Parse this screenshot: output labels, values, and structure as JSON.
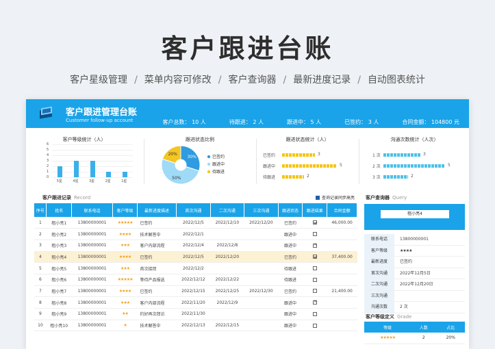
{
  "hero": {
    "title": "客户跟进台账",
    "features": [
      "客户星级管理",
      "菜单内容可修改",
      "客户查询器",
      "最新进度记录",
      "自动图表统计"
    ],
    "separator": "/"
  },
  "banner": {
    "title": "客户跟进管理台账",
    "subtitle": "Customer follow-up account",
    "stats": [
      "客户总数： 10 人",
      "待跟进： 2 人",
      "跟进中： 5 人",
      "已签约： 3 人",
      "合同金额： 104800 元"
    ],
    "accent": "#1aa3e8"
  },
  "charts": {
    "grade": {
      "title": "客户等级统计（人）",
      "y_ticks": [
        "6",
        "5",
        "4",
        "3",
        "2",
        "1",
        "0"
      ],
      "categories": [
        "5星",
        "4星",
        "3星",
        "2星",
        "1星"
      ],
      "values": [
        2,
        3,
        3,
        1,
        1
      ],
      "ylim": [
        0,
        6
      ]
    },
    "status_ratio": {
      "title": "跟进状态比例",
      "slices": [
        {
          "name": "已签约",
          "value": 30,
          "label": "30%",
          "color": "#2f9be0"
        },
        {
          "name": "跟进中",
          "value": 50,
          "label": "50%",
          "color": "#9fdaf7"
        },
        {
          "name": "待跟进",
          "value": 20,
          "label": "20%",
          "color": "#f3c623"
        }
      ]
    },
    "status_count": {
      "title": "跟进状态统计（人）",
      "rows": [
        {
          "name": "已签约",
          "value": 3
        },
        {
          "name": "跟进中",
          "value": 5
        },
        {
          "name": "待跟进",
          "value": 2
        }
      ]
    },
    "comm_count": {
      "title": "沟通次数统计（人次）",
      "rows": [
        {
          "name": "1 次",
          "value": 3
        },
        {
          "name": "2 次",
          "value": 5
        },
        {
          "name": "3 次",
          "value": 2
        }
      ]
    }
  },
  "records": {
    "title": "客户跟进记录",
    "title_en": "Record",
    "sync_label": "查询记录同步高亮",
    "columns": [
      "序号",
      "姓名",
      "联系电话",
      "客户等级",
      "最新进度描述",
      "首次沟通",
      "二次沟通",
      "三次沟通",
      "跟进状态",
      "跟进结果",
      "合同金额"
    ],
    "rows": [
      {
        "no": "1",
        "name": "租小亮1",
        "phone": "13800000001",
        "stars": "★★★★★",
        "progress": "已签约",
        "c1": "2022/12/5",
        "c2": "2022/12/10",
        "c3": "2022/12/20",
        "status": "已签约",
        "result": "on",
        "amount": "46,000.00",
        "hl": false
      },
      {
        "no": "2",
        "name": "租小亮2",
        "phone": "13800000001",
        "stars": "★★★★",
        "progress": "技术解答中",
        "c1": "2022/12/1",
        "c2": "",
        "c3": "",
        "status": "跟进中",
        "result": "off",
        "amount": "",
        "hl": false
      },
      {
        "no": "3",
        "name": "租小亮3",
        "phone": "13800000001",
        "stars": "★★★",
        "progress": "客户内部流程",
        "c1": "2022/12/4",
        "c2": "2022/12/8",
        "c3": "",
        "status": "跟进中",
        "result": "x",
        "amount": "",
        "hl": false
      },
      {
        "no": "4",
        "name": "租小亮4",
        "phone": "13800000001",
        "stars": "★★★★",
        "progress": "已签约",
        "c1": "2022/12/5",
        "c2": "2022/12/20",
        "c3": "",
        "status": "已签约",
        "result": "on",
        "amount": "37,400.00",
        "hl": true
      },
      {
        "no": "5",
        "name": "租小亮5",
        "phone": "13800000001",
        "stars": "★★★",
        "progress": "首次接拜",
        "c1": "2022/12/2",
        "c2": "",
        "c3": "",
        "status": "待跟进",
        "result": "off",
        "amount": "",
        "hl": false
      },
      {
        "no": "6",
        "name": "租小亮6",
        "phone": "13800000001",
        "stars": "★★★★★",
        "progress": "等待产品报选",
        "c1": "2022/12/12",
        "c2": "2022/12/22",
        "c3": "",
        "status": "待跟进",
        "result": "off",
        "amount": "",
        "hl": false
      },
      {
        "no": "7",
        "name": "租小亮7",
        "phone": "13800000001",
        "stars": "★★★★",
        "progress": "已签约",
        "c1": "2022/12/15",
        "c2": "2022/12/25",
        "c3": "2022/12/30",
        "status": "已签约",
        "result": "off",
        "amount": "21,400.00",
        "hl": false
      },
      {
        "no": "8",
        "name": "租小亮8",
        "phone": "13800000001",
        "stars": "★★★",
        "progress": "客户内部流程",
        "c1": "2022/11/20",
        "c2": "2022/12/9",
        "c3": "",
        "status": "跟进中",
        "result": "x",
        "amount": "",
        "hl": false
      },
      {
        "no": "9",
        "name": "租小亮9",
        "phone": "13800000001",
        "stars": "★★",
        "progress": "约好再次拜访",
        "c1": "2022/11/30",
        "c2": "",
        "c3": "",
        "status": "跟进中",
        "result": "off",
        "amount": "",
        "hl": false
      },
      {
        "no": "10",
        "name": "租小亮10",
        "phone": "13800000001",
        "stars": "★",
        "progress": "技术解答中",
        "c1": "2022/12/13",
        "c2": "2022/12/15",
        "c3": "",
        "status": "跟进中",
        "result": "off",
        "amount": "",
        "hl": false
      }
    ]
  },
  "query": {
    "title": "客户查询器",
    "title_en": "Query",
    "input_value": "租小亮4",
    "rows": [
      {
        "k": "联系电话",
        "v": "13800000001"
      },
      {
        "k": "客户等级",
        "v": "★★★★"
      },
      {
        "k": "最新进度",
        "v": "已签约"
      },
      {
        "k": "首次沟通",
        "v": "2022年12月5日"
      },
      {
        "k": "二次沟通",
        "v": "2022年12月20日"
      },
      {
        "k": "三次沟通",
        "v": ""
      },
      {
        "k": "沟通次数",
        "v": "2 次"
      }
    ]
  },
  "grade_def": {
    "title": "客户等级定义",
    "title_en": "Grade",
    "columns": [
      "等级",
      "人数",
      "占比"
    ],
    "rows": [
      {
        "grade": "★★★★★",
        "count": "2",
        "ratio": "20%"
      }
    ]
  }
}
